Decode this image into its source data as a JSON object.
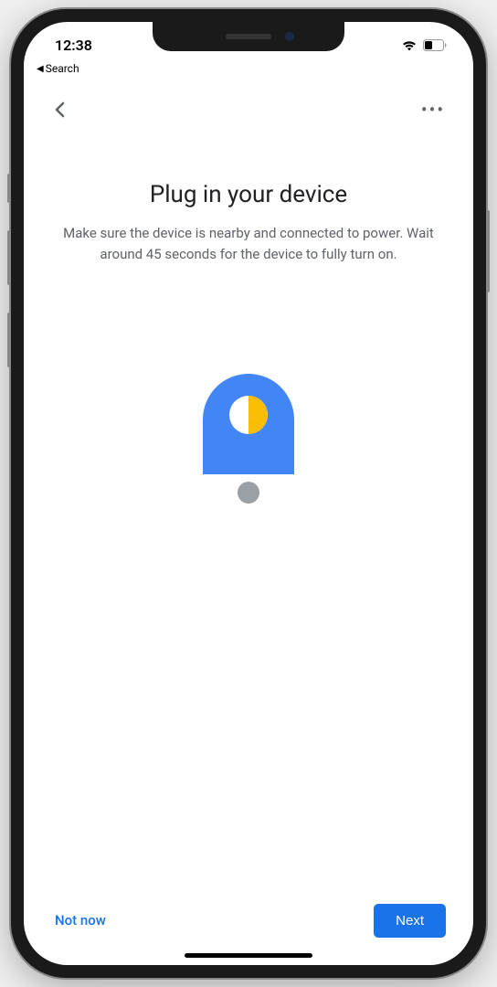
{
  "status_bar": {
    "time": "12:38",
    "back_app_label": "Search"
  },
  "header": {},
  "content": {
    "title": "Plug in your device",
    "subtitle": "Make sure the device is nearby and connected to power. Wait around 45 seconds for the device to fully turn on."
  },
  "footer": {
    "not_now_label": "Not now",
    "next_label": "Next"
  },
  "colors": {
    "primary_blue": "#1a73e8",
    "illustration_blue": "#4285f4",
    "illustration_yellow": "#fbbc04",
    "illustration_grey": "#9aa0a6",
    "text_primary": "#202124",
    "text_secondary": "#5f6368"
  }
}
